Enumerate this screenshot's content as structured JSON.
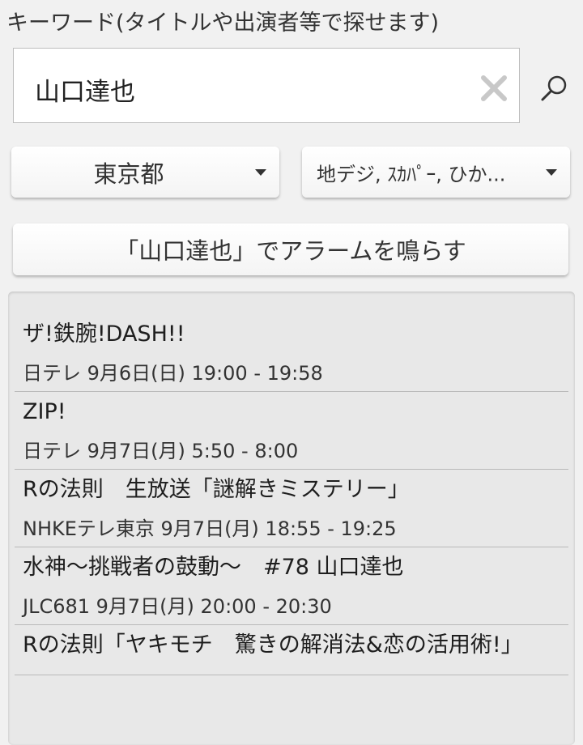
{
  "search": {
    "label": "キーワード(タイトルや出演者等で探せます)",
    "value": "山口達也"
  },
  "filters": {
    "prefecture": "東京都",
    "broadcast_sources": "地デジ, ｽｶﾊﾟｰ, ひか..."
  },
  "alarm_button_label": "「山口達也」でアラームを鳴らす",
  "results": [
    {
      "title": "ザ!鉄腕!DASH!!",
      "meta": "日テレ 9月6日(日) 19:00 - 19:58"
    },
    {
      "title": "ZIP!",
      "meta": "日テレ 9月7日(月) 5:50 - 8:00"
    },
    {
      "title": "Rの法則　生放送「謎解きミステリー」",
      "meta": "NHKEテレ東京 9月7日(月) 18:55 - 19:25"
    },
    {
      "title": "水神～挑戦者の鼓動～　#78 山口達也",
      "meta": "JLC681 9月7日(月) 20:00 - 20:30"
    },
    {
      "title": "Rの法則「ヤキモチ　驚きの解消法&恋の活用術!」",
      "meta": ""
    }
  ]
}
